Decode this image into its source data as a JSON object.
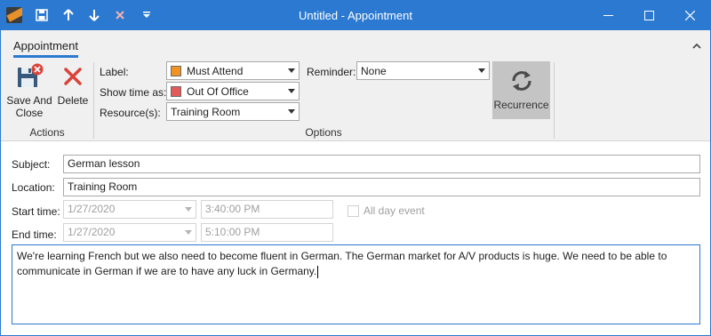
{
  "window": {
    "title": "Untitled - Appointment",
    "accent_color": "#2b79d0"
  },
  "quick_access": {
    "save_icon": "save-icon",
    "up_icon": "arrow-up-icon",
    "down_icon": "arrow-down-icon",
    "delete_icon": "close-icon",
    "customize_icon": "dropdown-arrow-icon"
  },
  "ribbon": {
    "tab_label": "Appointment",
    "actions": {
      "save_label_line1": "Save And",
      "save_label_line2": "Close",
      "delete_label": "Delete",
      "group_label": "Actions"
    },
    "options": {
      "label_caption": "Label:",
      "label_value": "Must Attend",
      "label_color": "#f29222",
      "show_time_caption": "Show time as:",
      "show_time_value": "Out Of Office",
      "show_time_color": "#e35a5a",
      "resource_caption": "Resource(s):",
      "resource_value": "Training Room",
      "reminder_caption": "Reminder:",
      "reminder_value": "None",
      "recurrence_label": "Recurrence",
      "group_label": "Options"
    }
  },
  "form": {
    "subject_label": "Subject:",
    "subject_value": "German lesson",
    "location_label": "Location:",
    "location_value": "Training Room",
    "start_label": "Start time:",
    "start_date": "1/27/2020",
    "start_time": "3:40:00 PM",
    "end_label": "End time:",
    "end_date": "1/27/2020",
    "end_time": "5:10:00 PM",
    "all_day_label": "All day event",
    "notes": "We're learning French but we also need to become fluent in German. The German market for A/V products is huge. We need to be able to communicate in German if we are to have any luck in Germany."
  }
}
